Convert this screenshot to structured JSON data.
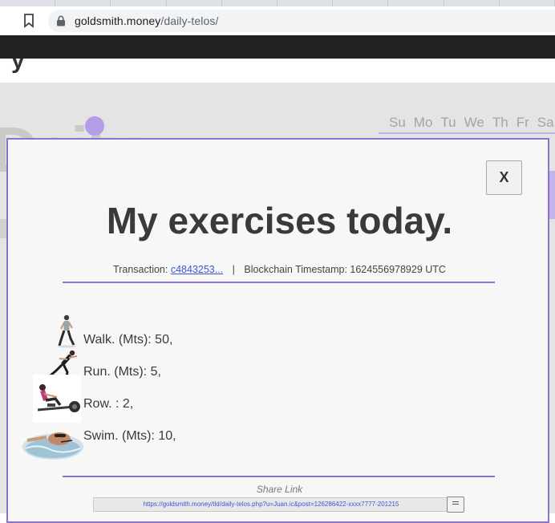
{
  "browser": {
    "url_domain": "goldsmith.money",
    "url_path": "/daily-telos/"
  },
  "background_page": {
    "logo_text": "Daily",
    "weekdays": [
      "Su",
      "Mo",
      "Tu",
      "We",
      "Th",
      "Fr",
      "Sa"
    ]
  },
  "modal": {
    "close_label": "X",
    "title": "My exercises today.",
    "transaction_label": "Transaction:",
    "transaction_link": "c4843253...",
    "separator": "|",
    "timestamp_text": "Blockchain Timestamp: 1624556978929 UTC",
    "exercises": [
      {
        "label": "Walk. (Mts): 50,",
        "icon": "walker-image"
      },
      {
        "label": "Run. (Mts): 5,",
        "icon": "runner-image"
      },
      {
        "label": "Row. : 2,",
        "icon": "rowing-machine-image"
      },
      {
        "label": "Swim. (Mts): 10,",
        "icon": "swimmer-image"
      }
    ],
    "share_label": "Share Link",
    "share_url": "https://goldsmith.money/tld/daily-telos.php?u=Juan.ic&post=126286422-xxxx7777-201215"
  },
  "colors": {
    "accent": "#8b71d4",
    "dark_bar": "#222222",
    "link": "#3b55d9"
  }
}
